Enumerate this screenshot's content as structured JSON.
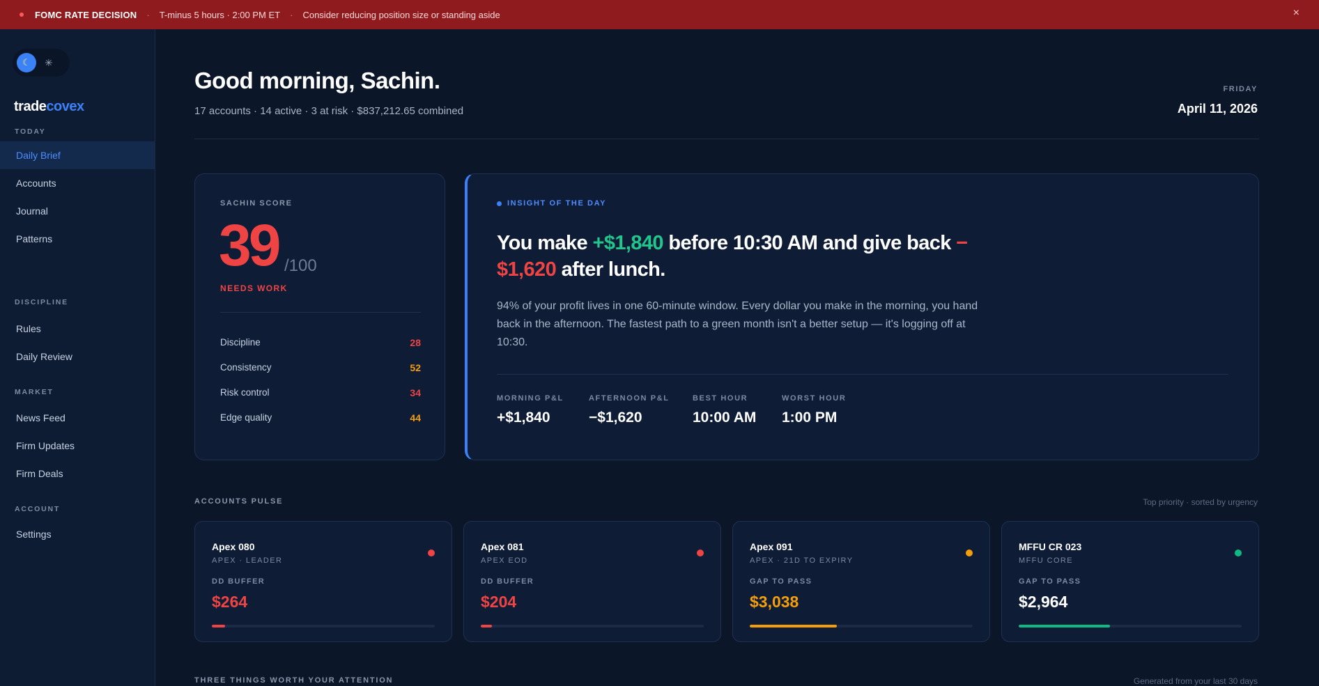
{
  "banner": {
    "title": "FOMC RATE DECISION",
    "countdown": "T-minus 5 hours · 2:00 PM ET",
    "advice": "Consider reducing position size or standing aside",
    "close": "×"
  },
  "sidebar": {
    "logo_a": "trade",
    "logo_b": "covex",
    "sections": {
      "today": "TODAY",
      "discipline": "DISCIPLINE",
      "market": "MARKET",
      "account": "ACCOUNT"
    },
    "items": {
      "daily_brief": "Daily Brief",
      "accounts": "Accounts",
      "journal": "Journal",
      "patterns": "Patterns",
      "rules": "Rules",
      "daily_review": "Daily Review",
      "news_feed": "News Feed",
      "firm_updates": "Firm Updates",
      "firm_deals": "Firm Deals",
      "settings": "Settings"
    }
  },
  "header": {
    "greeting": "Good morning, Sachin.",
    "summary": "17 accounts · 14 active · 3 at risk · $837,212.65 combined",
    "day": "FRIDAY",
    "date": "April 11, 2026"
  },
  "score": {
    "label": "SACHIN SCORE",
    "value": "39",
    "max": "/100",
    "status": "NEEDS WORK",
    "rows": [
      {
        "label": "Discipline",
        "value": "28",
        "color": "#ef4444"
      },
      {
        "label": "Consistency",
        "value": "52",
        "color": "#f59e0b"
      },
      {
        "label": "Risk control",
        "value": "34",
        "color": "#ef4444"
      },
      {
        "label": "Edge quality",
        "value": "44",
        "color": "#f59e0b"
      }
    ]
  },
  "insight": {
    "label": "INSIGHT OF THE DAY",
    "headline_a": "You make ",
    "headline_gain": "+$1,840",
    "headline_b": " before 10:30 AM and give back ",
    "headline_loss": "−$1,620",
    "headline_c": " after lunch.",
    "body": "94% of your profit lives in one 60-minute window. Every dollar you make in the morning, you hand back in the afternoon. The fastest path to a green month isn't a better setup — it's logging off at 10:30.",
    "stats": [
      {
        "label": "MORNING P&L",
        "value": "+$1,840"
      },
      {
        "label": "AFTERNOON P&L",
        "value": "−$1,620"
      },
      {
        "label": "BEST HOUR",
        "value": "10:00 AM"
      },
      {
        "label": "WORST HOUR",
        "value": "1:00 PM"
      }
    ]
  },
  "pulse": {
    "label": "ACCOUNTS PULSE",
    "note": "Top priority · sorted by urgency",
    "accounts": [
      {
        "name": "Apex 080",
        "sub": "APEX · LEADER",
        "metric": "DD BUFFER",
        "value": "$264",
        "color": "#ef4444",
        "progress": 0.06
      },
      {
        "name": "Apex 081",
        "sub": "APEX EOD",
        "metric": "DD BUFFER",
        "value": "$204",
        "color": "#ef4444",
        "progress": 0.05
      },
      {
        "name": "Apex 091",
        "sub": "APEX · 21D TO EXPIRY",
        "metric": "GAP TO PASS",
        "value": "$3,038",
        "color": "#f59e0b",
        "progress": 0.39
      },
      {
        "name": "MFFU CR 023",
        "sub": "MFFU CORE",
        "metric": "GAP TO PASS",
        "value": "$2,964",
        "color": "#10b981",
        "progress": 0.41
      }
    ]
  },
  "attention": {
    "label": "THREE THINGS WORTH YOUR ATTENTION",
    "note": "Generated from your last 30 days"
  }
}
